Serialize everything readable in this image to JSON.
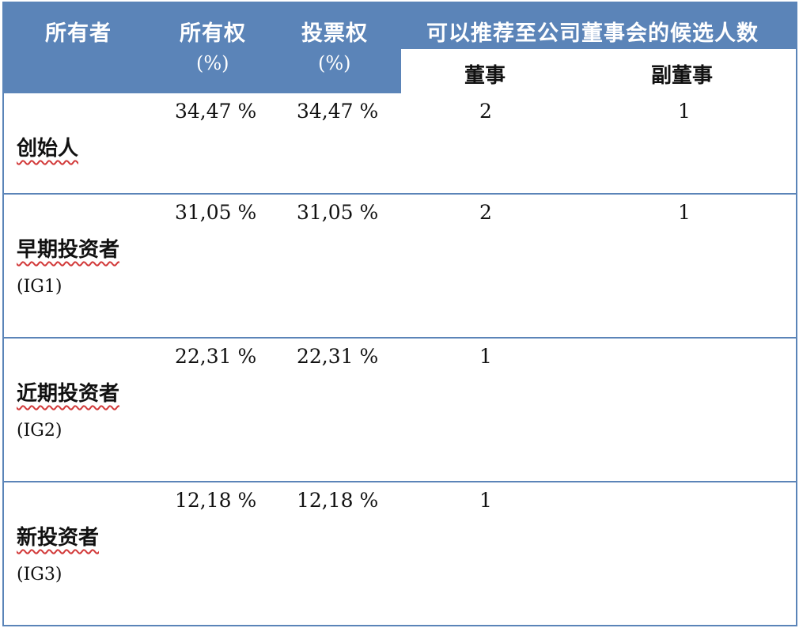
{
  "header": {
    "owner": "所有者",
    "ownership": "所有权",
    "ownership_unit": "(%)",
    "voting": "投票权",
    "voting_unit": "(%)",
    "nominees": "可以推荐至公司董事会的候选人数",
    "director": "董事",
    "vice_director": "副董事"
  },
  "rows": [
    {
      "name": "创始人",
      "code": "",
      "ownership": "34,47 %",
      "voting": "34,47 %",
      "director": "2",
      "vice_director": "1"
    },
    {
      "name": "早期投资者",
      "code": "(IG1)",
      "ownership": "31,05 %",
      "voting": "31,05 %",
      "director": "2",
      "vice_director": "1"
    },
    {
      "name": "近期投资者",
      "code": "(IG2)",
      "ownership": "22,31 %",
      "voting": "22,31 %",
      "director": "1",
      "vice_director": ""
    },
    {
      "name": "新投资者",
      "code": "(IG3)",
      "ownership": "12,18 %",
      "voting": "12,18 %",
      "director": "1",
      "vice_director": ""
    }
  ],
  "colors": {
    "header_bg": "#5b84b8",
    "border": "#5b84b8",
    "spell_underline": "#d23a3a"
  }
}
